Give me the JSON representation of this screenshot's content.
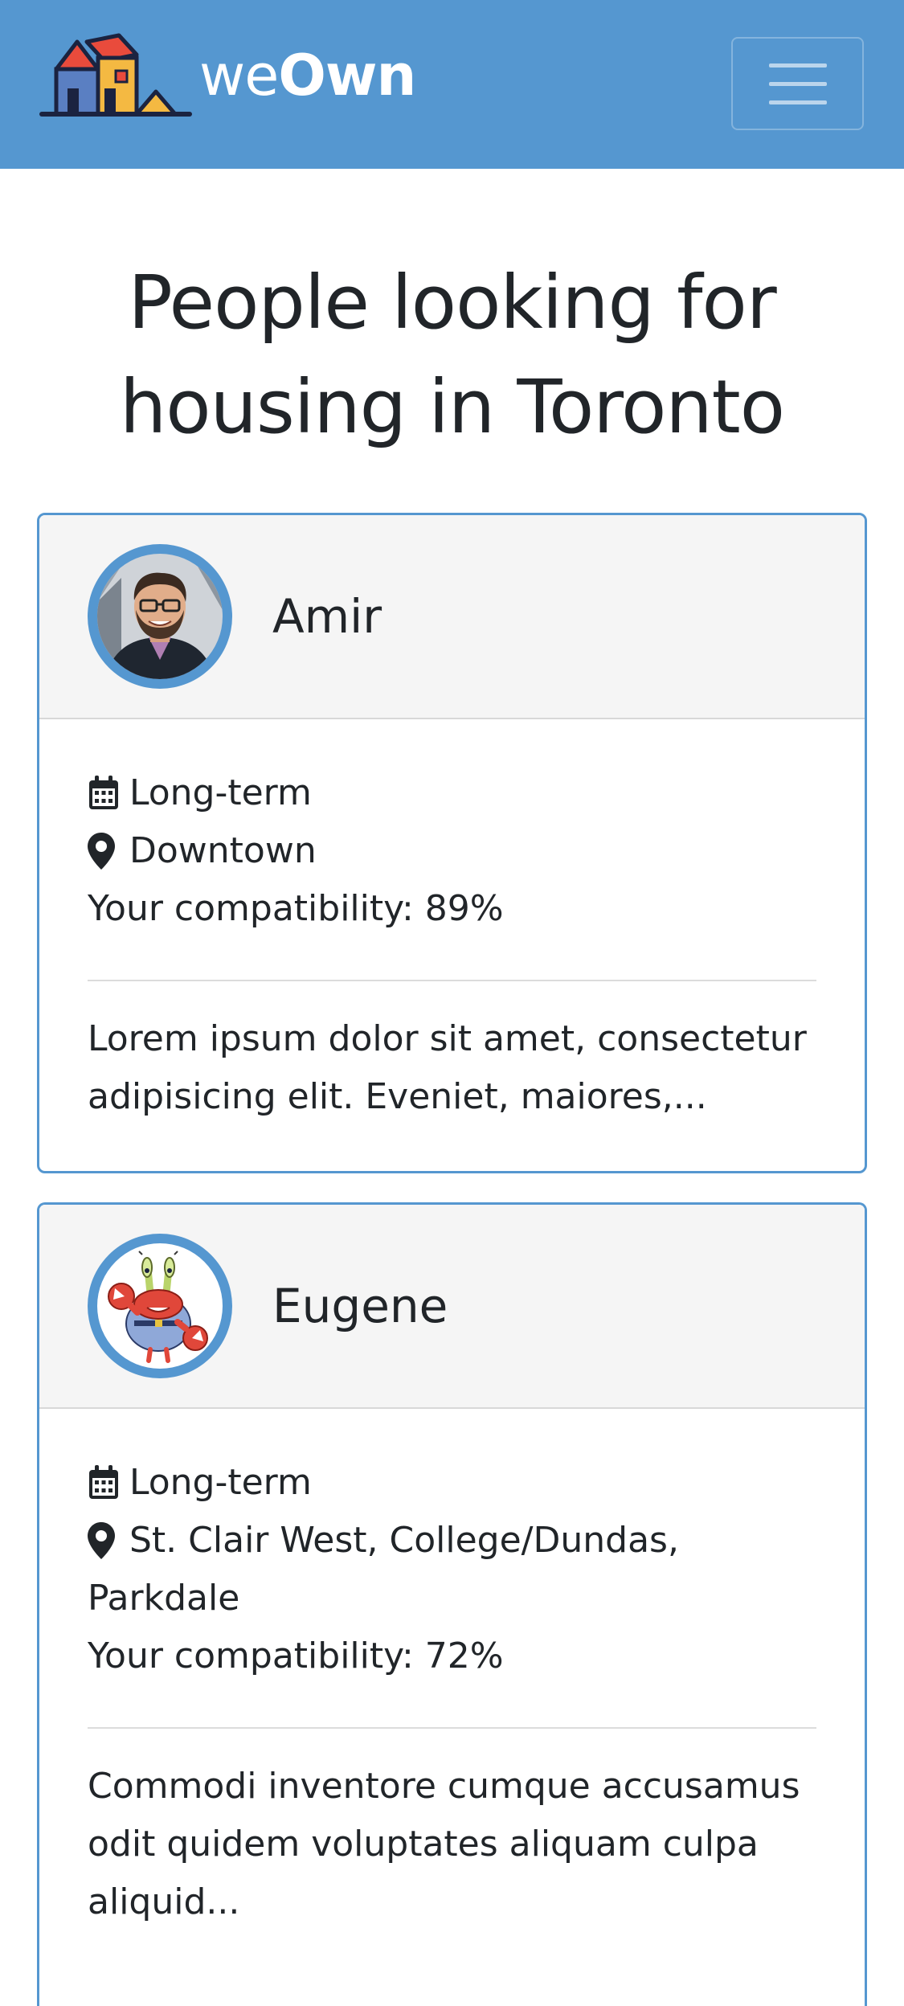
{
  "navbar": {
    "brand_light": "we",
    "brand_bold": "Own",
    "brand_color": "#5597d0",
    "menu_icon": "hamburger-menu-icon"
  },
  "page": {
    "title_line1": "People looking for",
    "title_line2": "housing in Toronto"
  },
  "profiles": [
    {
      "name": "Amir",
      "avatar": "person-photo-avatar",
      "term_icon": "calendar-icon",
      "term": "Long-term",
      "location_icon": "map-marker-icon",
      "location_line1": "Downtown",
      "location_line2": "",
      "compatibility": "Your compatibility: 89%",
      "description": "Lorem ipsum dolor sit amet, consectetur adipisicing elit. Eveniet, maiores,..."
    },
    {
      "name": "Eugene",
      "avatar": "crab-cartoon-avatar",
      "term_icon": "calendar-icon",
      "term": "Long-term",
      "location_icon": "map-marker-icon",
      "location_line1": "St. Clair West, College/Dundas,",
      "location_line2": "Parkdale",
      "compatibility": "Your compatibility: 72%",
      "description": "Commodi inventore cumque accusamus odit quidem voluptates aliquam culpa aliquid..."
    }
  ]
}
